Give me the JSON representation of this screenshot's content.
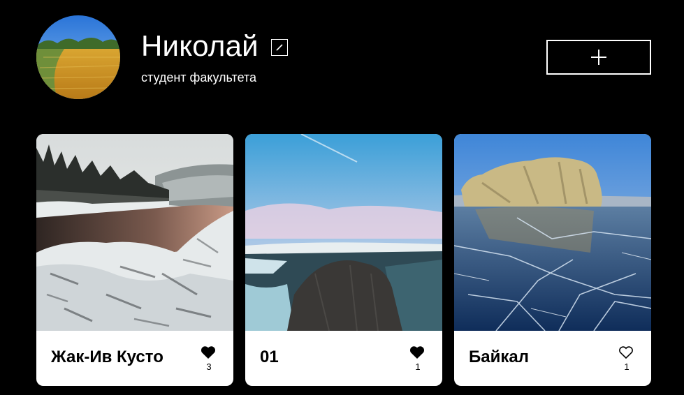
{
  "profile": {
    "name": "Николай",
    "about": "студент факультета"
  },
  "buttons": {
    "add_icon": "plus-icon",
    "edit_icon": "pencil-icon"
  },
  "cards": [
    {
      "title": "Жак-Ив Кусто",
      "likes": "3",
      "liked": true
    },
    {
      "title": "01",
      "likes": "1",
      "liked": true
    },
    {
      "title": "Байкал",
      "likes": "1",
      "liked": false
    }
  ],
  "colors": {
    "background": "#000000",
    "card": "#FFFFFF",
    "text_dark": "#000000",
    "text_light": "#FFFFFF"
  }
}
